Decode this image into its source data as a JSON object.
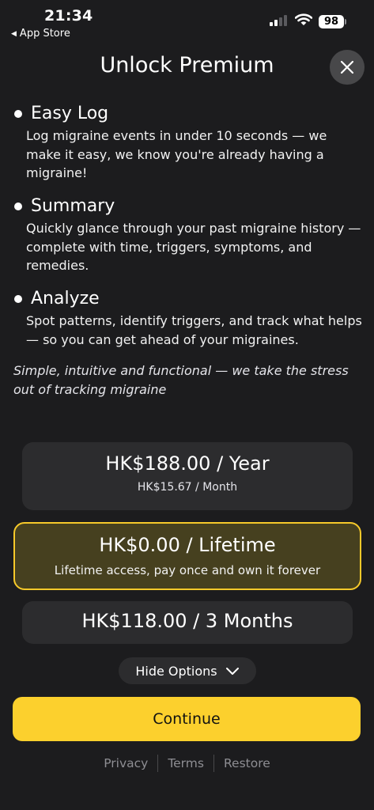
{
  "status": {
    "time": "21:34",
    "back_label": "App Store",
    "battery": "98"
  },
  "title": "Unlock Premium",
  "features": [
    {
      "title": "Easy Log",
      "desc": "Log migraine events in under 10 seconds — we make it easy, we know you're already having a migraine!"
    },
    {
      "title": "Summary",
      "desc": "Quickly glance through your past migraine history — complete with time, triggers, symptoms, and remedies."
    },
    {
      "title": "Analyze",
      "desc": "Spot patterns, identify triggers, and track what helps — so you can get ahead of your migraines."
    }
  ],
  "tagline": "Simple, intuitive and functional — we take the stress out of tracking migraine",
  "plans": {
    "yearly": {
      "price": "HK$188.00 / Year",
      "sub": "HK$15.67 / Month"
    },
    "lifetime": {
      "price": "HK$0.00 / Lifetime",
      "sub": "Lifetime access, pay once and own it forever",
      "selected": true
    },
    "quarterly": {
      "price": "HK$118.00 / 3 Months"
    }
  },
  "toggle_label": "Hide Options",
  "continue_label": "Continue",
  "footer": {
    "privacy": "Privacy",
    "terms": "Terms",
    "restore": "Restore"
  },
  "colors": {
    "accent": "#fcd02d",
    "selected_bg": "#46401f",
    "background": "#1c1c1e",
    "card": "#2c2c2e"
  },
  "icons": {
    "close": "close-icon",
    "chevron": "chevron-down-icon",
    "wifi": "wifi-icon",
    "signal": "signal-icon",
    "battery": "battery-icon"
  }
}
